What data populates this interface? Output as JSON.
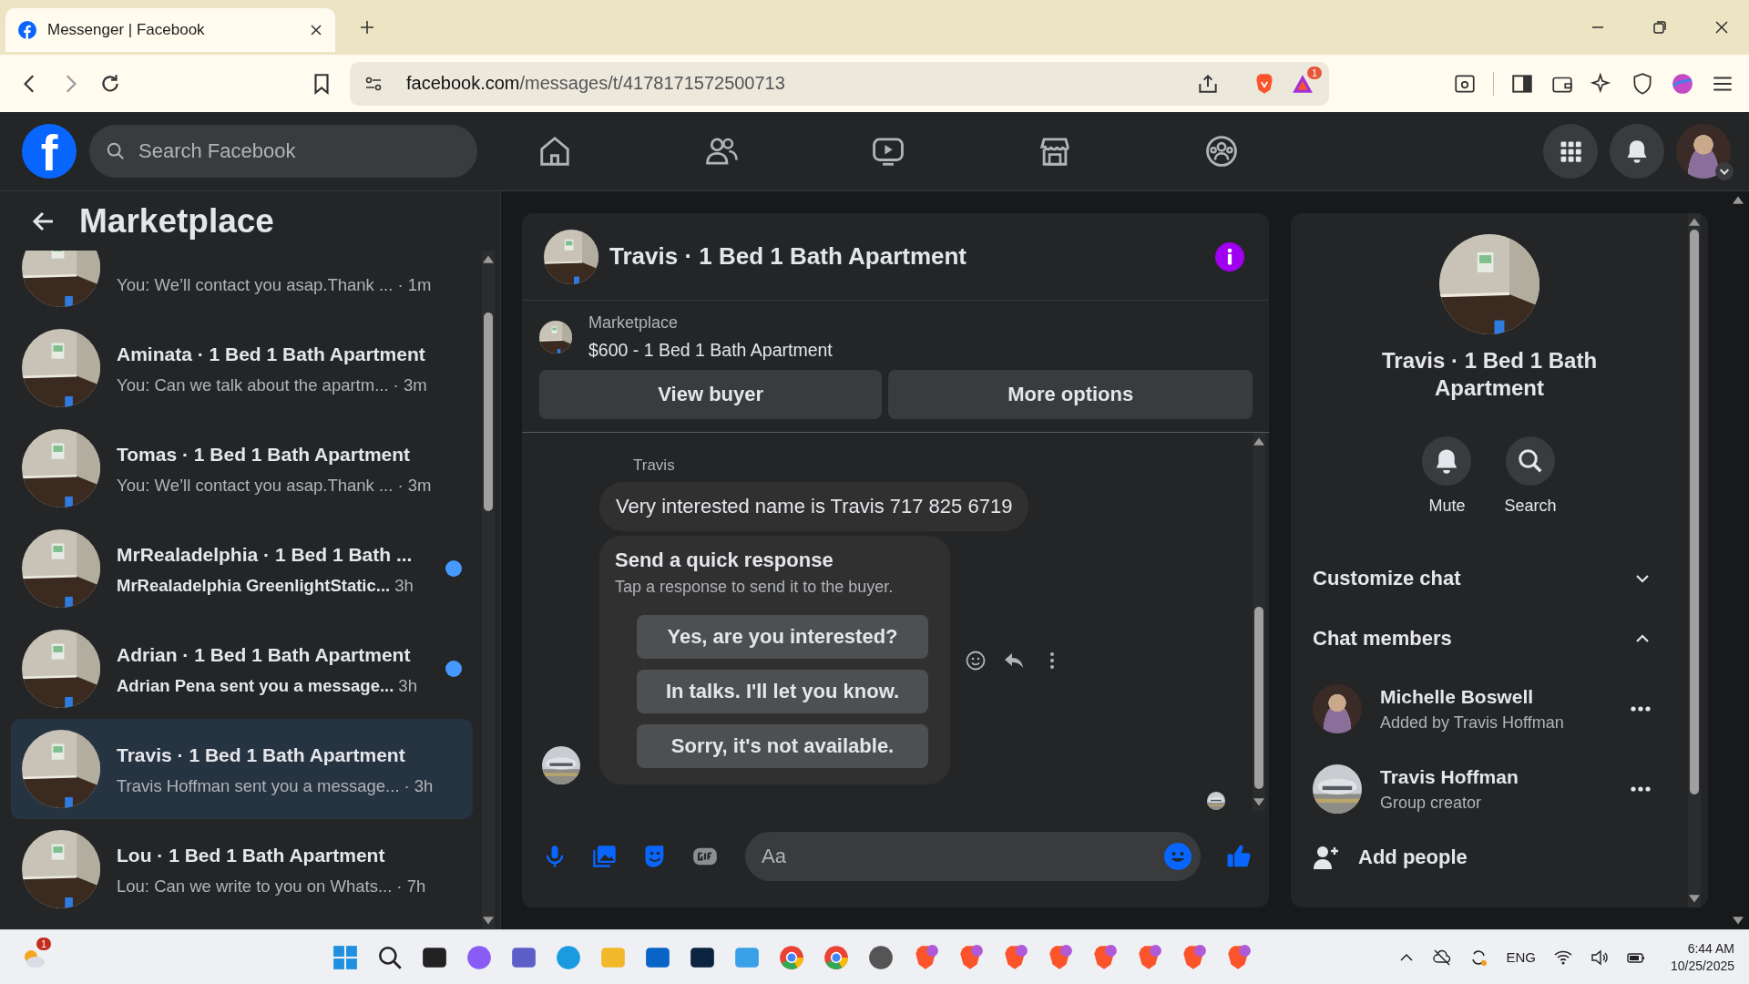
{
  "browser": {
    "tab_title": "Messenger | Facebook",
    "url_domain": "facebook.com",
    "url_path": "/messages/t/4178171572500713",
    "rewards_badge": "1"
  },
  "header": {
    "logo": "f",
    "search_placeholder": "Search Facebook"
  },
  "sidebar": {
    "title": "Marketplace",
    "conversations": [
      {
        "preview": "You: We’ll contact you asap.Thank ...",
        "time": "· 1m",
        "unread": false,
        "selected": false
      },
      {
        "title": "Aminata · 1 Bed 1 Bath Apartment",
        "preview": "You: Can we talk about the apartm...",
        "time": "· 3m",
        "unread": false,
        "selected": false
      },
      {
        "title": "Tomas · 1 Bed 1 Bath Apartment",
        "preview": "You: We’ll contact you asap.Thank ...",
        "time": "· 3m",
        "unread": false,
        "selected": false
      },
      {
        "title": "MrRealadelphia · 1 Bed 1 Bath ...",
        "preview": "MrRealadelphia GreenlightStatic...",
        "time": "3h",
        "unread": true,
        "selected": false
      },
      {
        "title": "Adrian · 1 Bed 1 Bath Apartment",
        "preview": "Adrian Pena sent you a message...",
        "time": "3h",
        "unread": true,
        "selected": false
      },
      {
        "title": "Travis · 1 Bed 1 Bath Apartment",
        "preview": "Travis Hoffman sent you a message...",
        "time": "· 3h",
        "unread": false,
        "selected": true
      },
      {
        "title": "Lou · 1 Bed 1 Bath Apartment",
        "preview": "Lou: Can we write to you on Whats...",
        "time": "· 7h",
        "unread": false,
        "selected": false
      }
    ]
  },
  "chat": {
    "title": "Travis · 1 Bed 1 Bath Apartment",
    "listing_source": "Marketplace",
    "listing": "$600 - 1 Bed 1 Bath Apartment",
    "actions": [
      "View buyer",
      "More options"
    ],
    "sender": "Travis",
    "message": "Very interested name is Travis 717 825 6719",
    "quick_response": {
      "title": "Send a quick response",
      "hint": "Tap a response to send it to the buyer.",
      "options": [
        "Yes, are you interested?",
        "In talks. I'll let you know.",
        "Sorry, it's not available."
      ]
    },
    "composer": {
      "placeholder": "Aa"
    }
  },
  "details": {
    "title": "Travis · 1 Bed 1 Bath Apartment",
    "actions": [
      {
        "label": "Mute",
        "kind": "mute"
      },
      {
        "label": "Search",
        "kind": "search"
      }
    ],
    "sections": [
      {
        "label": "Customize chat",
        "expanded": false
      },
      {
        "label": "Chat members",
        "expanded": true
      }
    ],
    "members": [
      {
        "name": "Michelle Boswell",
        "role": "Added by Travis Hoffman",
        "kind": "person"
      },
      {
        "name": "Travis Hoffman",
        "role": "Group creator",
        "kind": "car"
      }
    ],
    "add_people": "Add people"
  },
  "taskbar": {
    "weather_badge": "1",
    "language": "ENG",
    "time": "6:44 AM",
    "date": "10/25/2025"
  }
}
